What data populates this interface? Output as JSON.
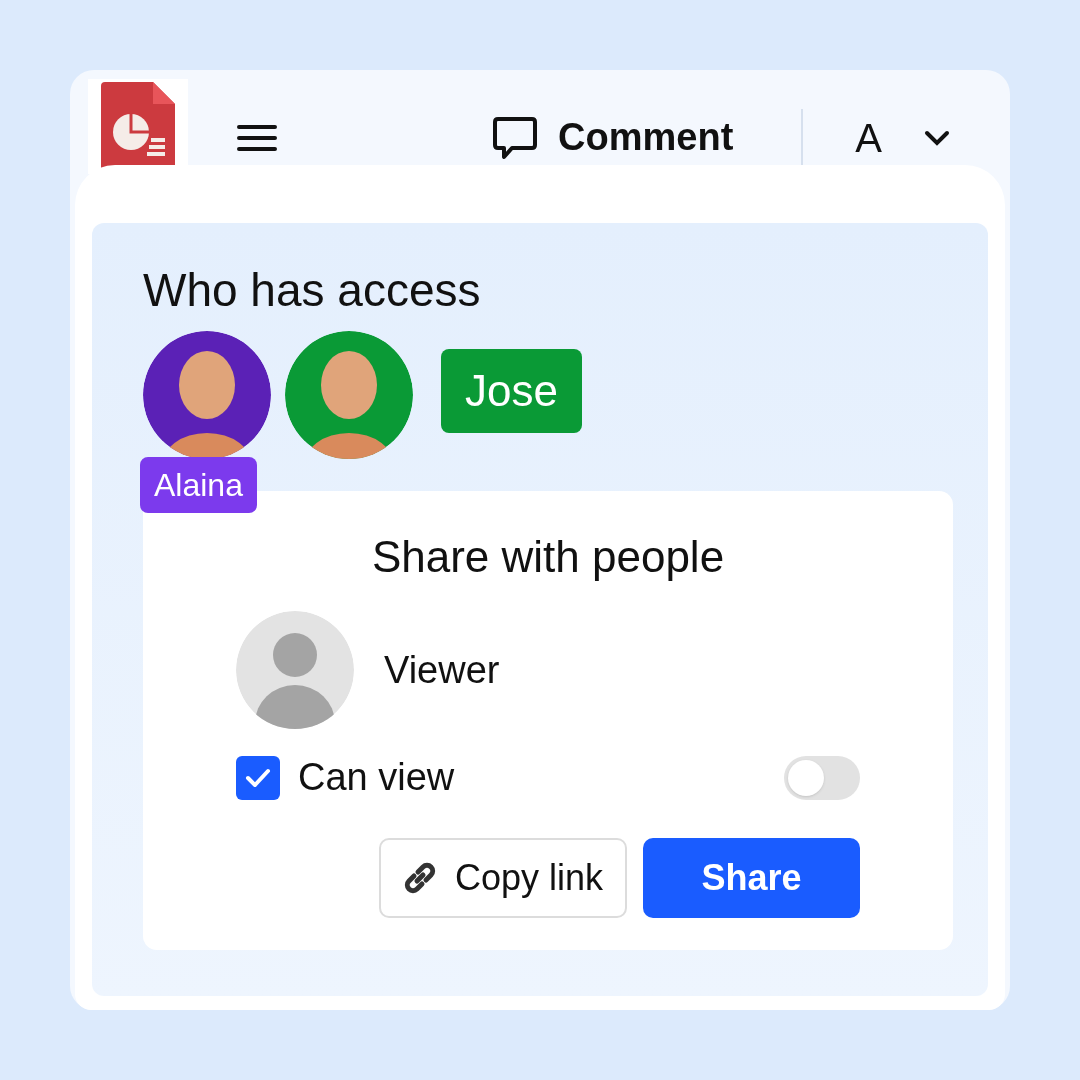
{
  "toolbar": {
    "comment": "Comment",
    "account": "A"
  },
  "access": {
    "title": "Who has access",
    "people": [
      {
        "kind": "below",
        "avatar": {
          "color": "#5b21b6"
        },
        "tag": {
          "name": "Alaina",
          "color": "#7c3aed"
        }
      },
      {
        "kind": "beside",
        "avatar": {
          "color": "#0a9a36"
        },
        "tag": {
          "name": "Jose",
          "color": "#0a9a36"
        }
      }
    ]
  },
  "share": {
    "title": "Share with people",
    "role": "Viewer",
    "can_view": {
      "label": "Can view",
      "checked": true
    },
    "toggle": {
      "on": false
    },
    "buttons": [
      {
        "label": "Copy link",
        "kind": "secondary"
      },
      {
        "label": "Share",
        "kind": "primary"
      }
    ]
  }
}
